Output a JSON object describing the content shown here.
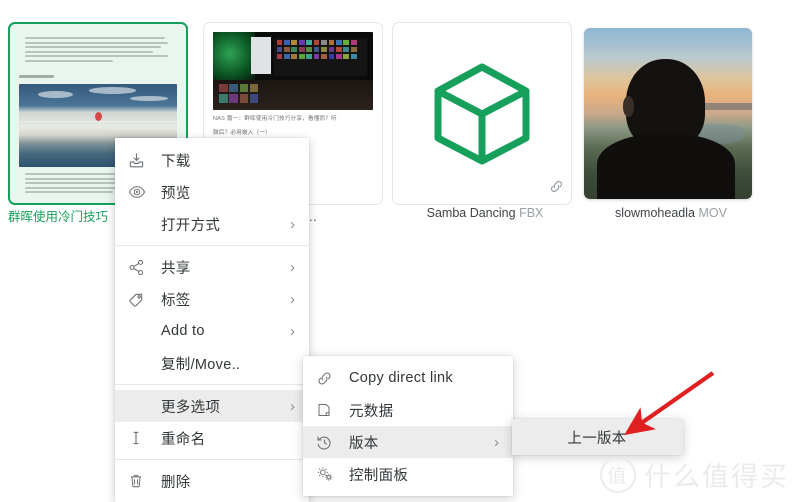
{
  "accent_color": "#14a05a",
  "grid": {
    "cards": [
      {
        "name": "card-document",
        "label": "群晖使用冷门技巧",
        "ext": "",
        "selected": true,
        "thumb": "document-preview",
        "has_link_badge": false
      },
      {
        "name": "card-nas-article",
        "label": "分享 (…",
        "ext": "",
        "selected": false,
        "thumb": "screenshot-preview",
        "has_link_badge": false,
        "caption": "NAS 篇一：群晖使用冷门技巧分享，看懂而？听",
        "caption2": "鼓后？必用嵌入（一）"
      },
      {
        "name": "card-samba-dancing",
        "label": "Samba Dancing",
        "ext": "FBX",
        "selected": false,
        "thumb": "cube-icon",
        "has_link_badge": true
      },
      {
        "name": "card-slowmohead",
        "label": "slowmoheadla",
        "ext": "MOV",
        "selected": false,
        "thumb": "photo-preview",
        "has_link_badge": false
      }
    ]
  },
  "context_menu": {
    "name": "file-context-menu",
    "items": [
      {
        "label": "下载",
        "icon": "download-icon",
        "has_submenu": false,
        "highlighted": false
      },
      {
        "label": "预览",
        "icon": "eye-icon",
        "has_submenu": false,
        "highlighted": false
      },
      {
        "label": "打开方式",
        "icon": "",
        "has_submenu": true,
        "highlighted": false
      },
      {
        "separator": true
      },
      {
        "label": "共享",
        "icon": "share-network-icon",
        "has_submenu": true,
        "highlighted": false
      },
      {
        "label": "标签",
        "icon": "tag-icon",
        "has_submenu": true,
        "highlighted": false
      },
      {
        "label": "Add to",
        "icon": "",
        "has_submenu": true,
        "highlighted": false
      },
      {
        "label": "复制/Move..",
        "icon": "",
        "has_submenu": false,
        "highlighted": false
      },
      {
        "separator": true
      },
      {
        "label": "更多选项",
        "icon": "",
        "has_submenu": true,
        "highlighted": true
      },
      {
        "label": "重命名",
        "icon": "text-cursor-icon",
        "has_submenu": false,
        "highlighted": false
      },
      {
        "separator": true
      },
      {
        "label": "删除",
        "icon": "trash-icon",
        "has_submenu": false,
        "highlighted": false
      }
    ]
  },
  "submenu": {
    "name": "more-options-submenu",
    "items": [
      {
        "label": "Copy direct link",
        "icon": "link-icon",
        "has_submenu": false,
        "highlighted": false
      },
      {
        "label": "元数据",
        "icon": "page-icon",
        "has_submenu": false,
        "highlighted": false
      },
      {
        "label": "版本",
        "icon": "history-clock-icon",
        "has_submenu": true,
        "highlighted": true
      },
      {
        "label": "控制面板",
        "icon": "gears-icon",
        "has_submenu": false,
        "highlighted": false
      }
    ]
  },
  "submenu2": {
    "name": "version-submenu",
    "items": [
      {
        "label": "上一版本",
        "icon": "",
        "has_submenu": false,
        "highlighted": true
      }
    ]
  },
  "annotation": {
    "name": "red-arrow-annotation",
    "color": "#e02020",
    "points_to": "上一版本"
  },
  "watermark": {
    "badge": "值",
    "text": "什么值得买"
  }
}
